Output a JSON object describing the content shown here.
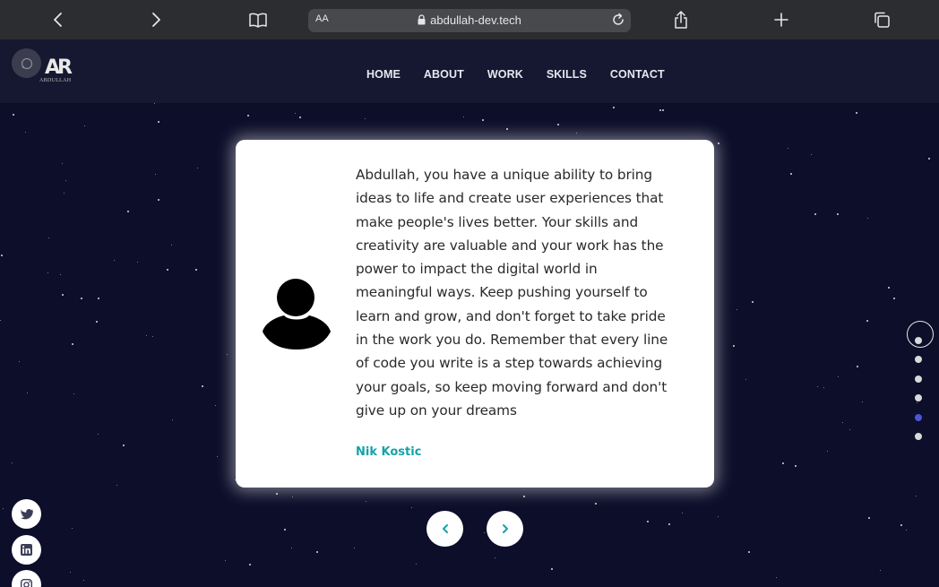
{
  "browser": {
    "url": "abdullah-dev.tech",
    "text_size_label": "AA"
  },
  "nav": {
    "logo_mark": "AR",
    "logo_text": "ABDULLAH",
    "links": [
      "HOME",
      "ABOUT",
      "WORK",
      "SKILLS",
      "CONTACT"
    ]
  },
  "testimonial": {
    "quote": "Abdullah, you have a unique ability to bring ideas to life and create user experiences that make people's lives better. Your skills and creativity are valuable and your work has the power to impact the digital world in meaningful ways. Keep pushing yourself to learn and grow, and don't forget to take pride in the work you do. Remember that every line of code you write is a step towards achieving your goals, so keep moving forward and don't give up on your dreams",
    "author": "Nik Kostic"
  },
  "pagination": {
    "total": 6,
    "active_index": 4
  },
  "colors": {
    "background": "#0c0e2a",
    "accent": "#14a3a8",
    "active_dot": "#4a55d8"
  },
  "socials": [
    "twitter-icon",
    "linkedin-icon",
    "instagram-icon"
  ]
}
